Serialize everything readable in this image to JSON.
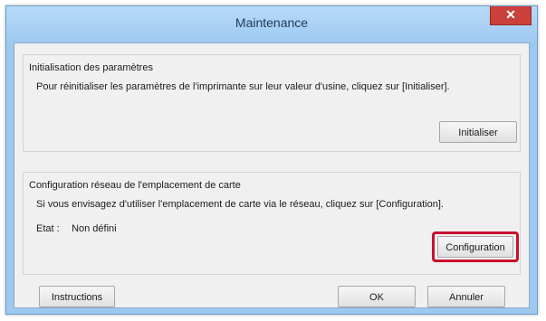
{
  "window": {
    "title": "Maintenance",
    "close_glyph": "✕"
  },
  "init_group": {
    "title": "Initialisation des paramètres",
    "description": "Pour réinitialiser les paramètres de l'imprimante sur leur valeur d'usine, cliquez sur [Initialiser].",
    "button_label": "Initialiser"
  },
  "network_group": {
    "title": "Configuration réseau de l'emplacement de carte",
    "description": "Si vous envisagez d'utiliser l'emplacement de carte via le réseau, cliquez sur [Configuration].",
    "state_label": "Etat :",
    "state_value": "Non défini",
    "button_label": "Configuration"
  },
  "footer": {
    "instructions_label": "Instructions",
    "ok_label": "OK",
    "cancel_label": "Annuler"
  },
  "colors": {
    "titlebar": "#9fcaf1",
    "close_button": "#c9413a",
    "highlight_border": "#c8102e"
  }
}
